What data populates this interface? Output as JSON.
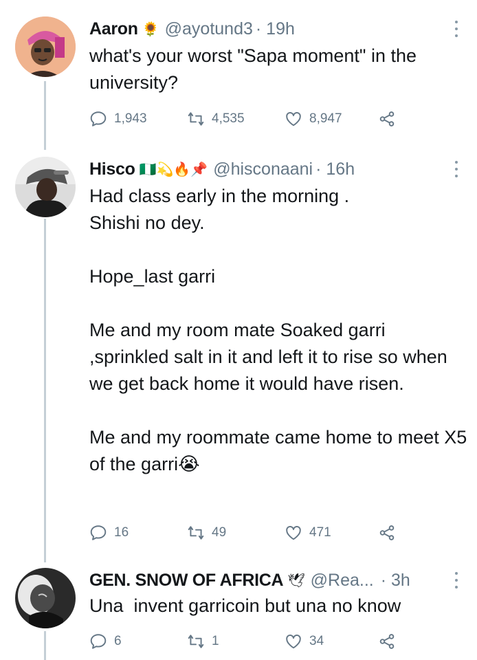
{
  "tweets": [
    {
      "name": "Aaron",
      "emoji": "🌻",
      "handle": "@ayotund3",
      "time": "· 19h",
      "body": [
        "what's your worst \"Sapa moment\" in the university?"
      ],
      "replies": "1,943",
      "retweets": "4,535",
      "likes": "8,947"
    },
    {
      "name": "Hisco",
      "emoji": "🇳🇬💫🔥📌",
      "handle": "@hisconaani",
      "time": "· 16h",
      "body": [
        "Had class early in the morning .",
        "Shishi no dey.",
        "",
        "Hope_last garri",
        "",
        "Me and my room mate Soaked garri ,sprinkled salt in it and left it to rise so when we get back home it would have risen.",
        "",
        "Me and my roommate came home to meet X5 of the garri😭"
      ],
      "replies": "16",
      "retweets": "49",
      "likes": "471"
    },
    {
      "name": "GEN. SNOW OF AFRICA",
      "emoji": "🕊",
      "handle": "@Rea...",
      "time": "· 3h",
      "body": [
        "Una  invent garricoin but una no know"
      ],
      "replies": "6",
      "retweets": "1",
      "likes": "34"
    }
  ],
  "icons": {
    "reply": "reply-icon",
    "retweet": "retweet-icon",
    "like": "heart-icon",
    "share": "share-icon",
    "more": "more-options-icon"
  },
  "colors": {
    "text": "#14171a",
    "muted": "#657786",
    "thread_line": "#c4cfd6"
  }
}
